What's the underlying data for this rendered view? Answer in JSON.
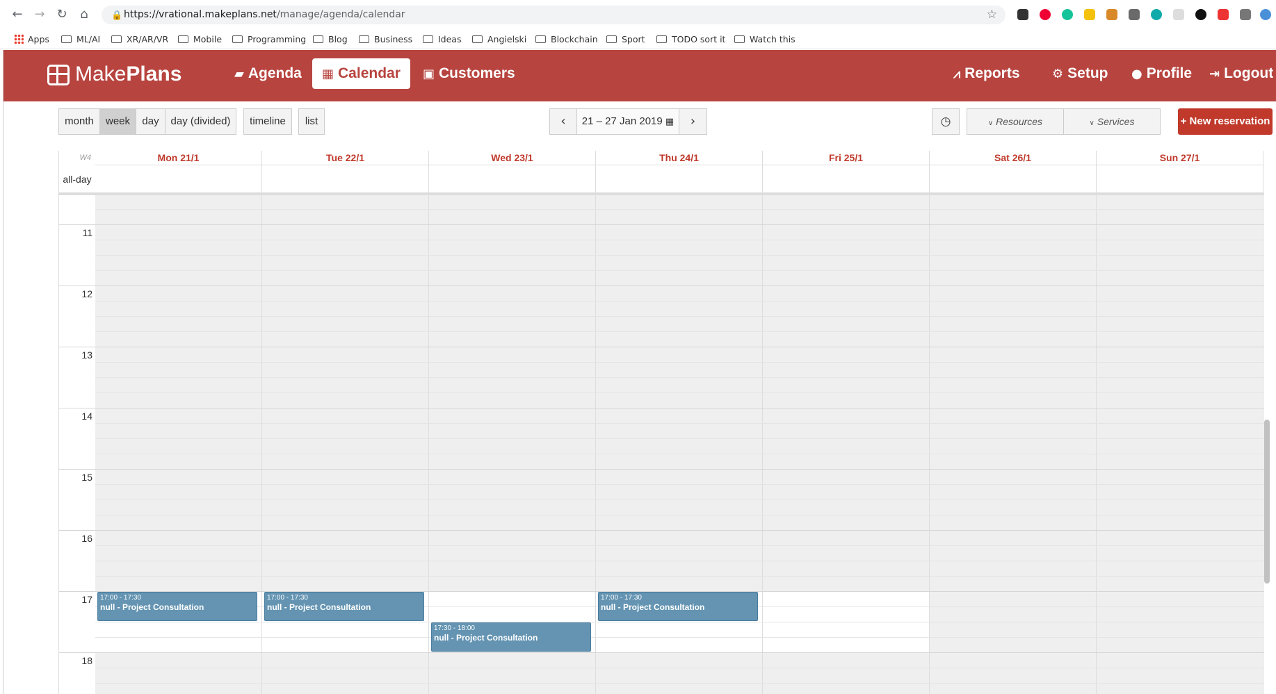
{
  "browser": {
    "url_host": "https://vrational.makeplans.net",
    "url_path": "/manage/agenda/calendar",
    "bookmarks": [
      "Apps",
      "ML/AI",
      "XR/AR/VR",
      "Mobile",
      "Programming",
      "Blog",
      "Business",
      "Ideas",
      "Angielski",
      "Blockchain",
      "Sport",
      "TODO sort it",
      "Watch this"
    ]
  },
  "app": {
    "logo_light": "Make",
    "logo_bold": "Plans",
    "nav_left": [
      {
        "label": "Agenda",
        "icon": "book-icon"
      },
      {
        "label": "Calendar",
        "icon": "calendar-icon",
        "active": true
      },
      {
        "label": "Customers",
        "icon": "contact-card-icon"
      }
    ],
    "nav_right": [
      {
        "label": "Reports",
        "icon": "line-chart-icon"
      },
      {
        "label": "Setup",
        "icon": "gear-icon"
      },
      {
        "label": "Profile",
        "icon": "user-icon"
      },
      {
        "label": "Logout",
        "icon": "sign-out-icon"
      }
    ]
  },
  "toolbar": {
    "views": [
      "month",
      "week",
      "day",
      "day (divided)"
    ],
    "active_view": "week",
    "timeline": "timeline",
    "list": "list",
    "date_range": "21 – 27 Jan 2019",
    "resources": "Resources",
    "services": "Services",
    "new_reservation": "New reservation"
  },
  "calendar": {
    "week_label": "W4",
    "allday_label": "all-day",
    "days": [
      "Mon 21/1",
      "Tue 22/1",
      "Wed 23/1",
      "Thu 24/1",
      "Fri 25/1",
      "Sat 26/1",
      "Sun 27/1"
    ],
    "hours": [
      "11",
      "12",
      "13",
      "14",
      "15",
      "16",
      "17",
      "18"
    ],
    "events": [
      {
        "day": 0,
        "time": "17:00 - 17:30",
        "title": "null - Project Consultation"
      },
      {
        "day": 1,
        "time": "17:00 - 17:30",
        "title": "null - Project Consultation"
      },
      {
        "day": 2,
        "time": "17:30 - 18:00",
        "title": "null - Project Consultation"
      },
      {
        "day": 3,
        "time": "17:00 - 17:30",
        "title": "null - Project Consultation"
      }
    ]
  },
  "colors": {
    "brand": "#b7443f",
    "today_red": "#c0392b",
    "event": "#6494b2"
  }
}
